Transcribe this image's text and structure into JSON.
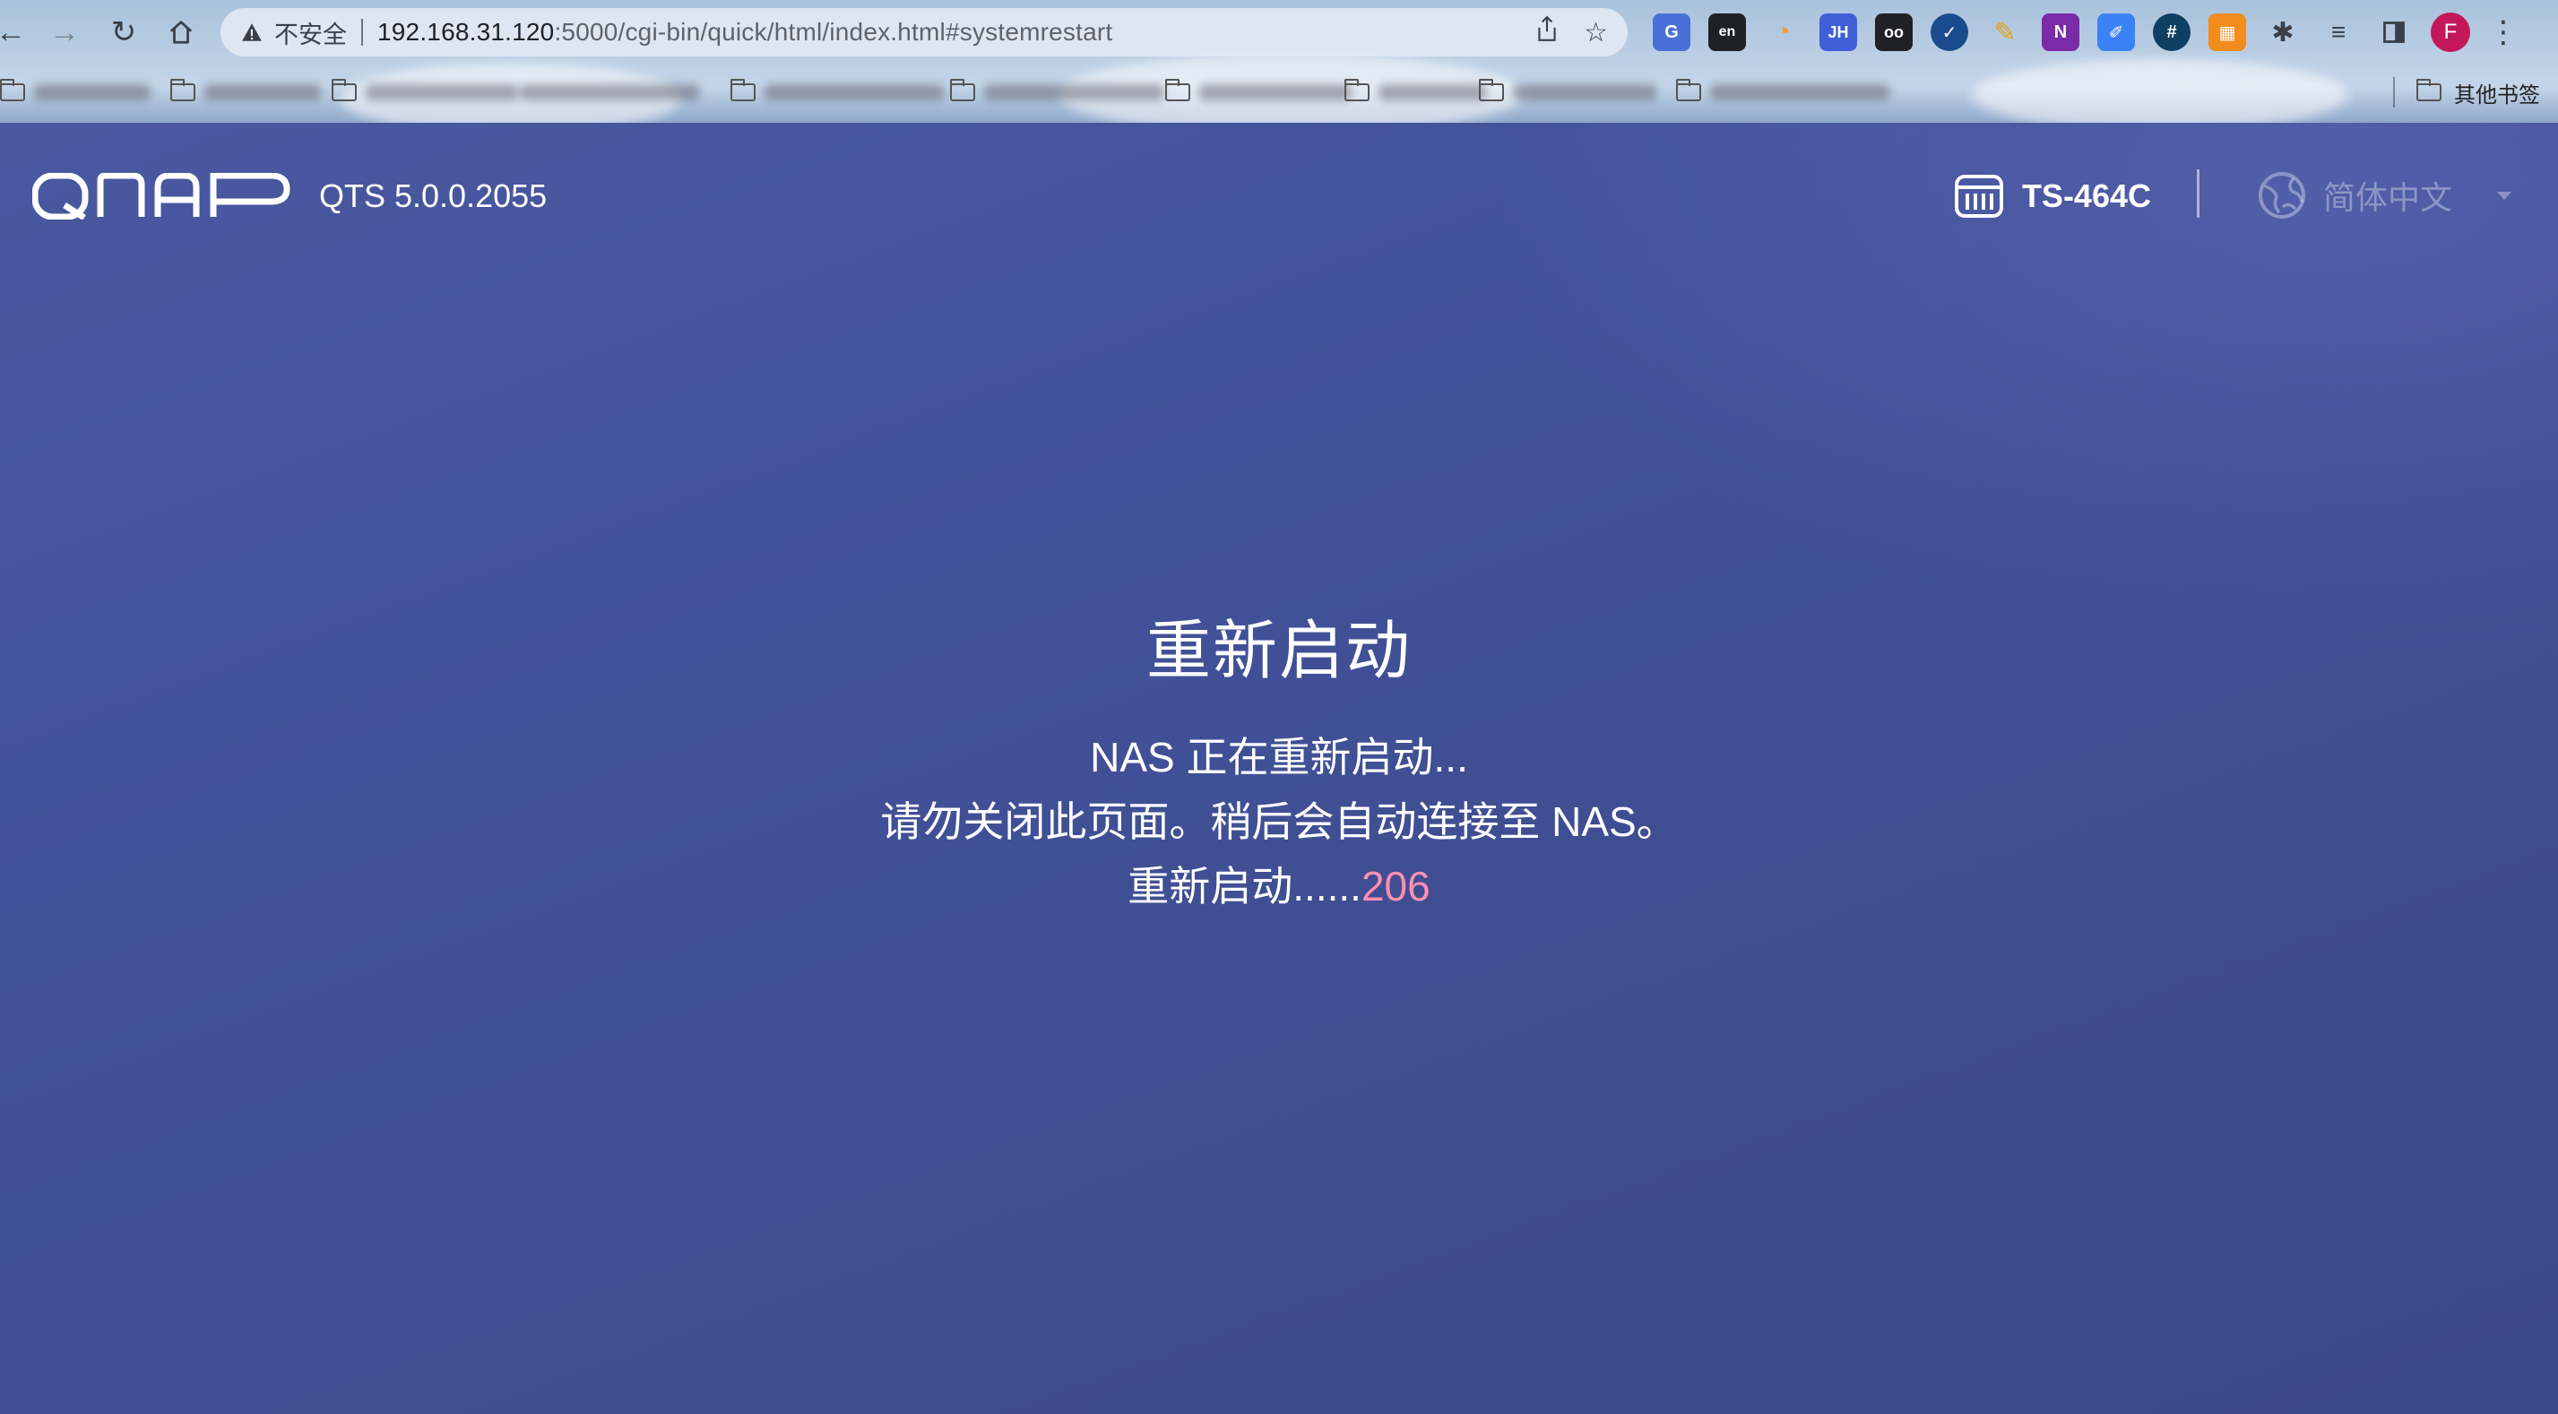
{
  "browser": {
    "security_label": "不安全",
    "url_main": "192.168.31.120",
    "url_rest": ":5000/cgi-bin/quick/html/index.html#systemrestart",
    "other_bookmarks": "其他书签",
    "profile_initial": "F",
    "extensions": [
      {
        "name": "google-translate-icon",
        "label": "G",
        "color": "#4a6fd6"
      },
      {
        "name": "dict-ext-icon",
        "label": "en",
        "color": "#202124"
      },
      {
        "name": "loading-ext-icon",
        "label": "◔",
        "color": "#f0a030"
      },
      {
        "name": "jh-ext-icon",
        "label": "JH",
        "color": "#3f5fd6"
      },
      {
        "name": "glasses-ext-icon",
        "label": "oo",
        "color": "#202124"
      },
      {
        "name": "check-ext-icon",
        "label": "✓",
        "color": "#1b4b8f"
      },
      {
        "name": "note-ext-icon",
        "label": "✎",
        "color": "#e8a21a"
      },
      {
        "name": "onenote-ext-icon",
        "label": "N",
        "color": "#7b2aa8"
      },
      {
        "name": "pen-ext-icon",
        "label": "✐",
        "color": "#3b82f6"
      },
      {
        "name": "hash-ext-icon",
        "label": "#",
        "color": "#0f3f63"
      },
      {
        "name": "grid-ext-icon",
        "label": "▦",
        "color": "#f28c1c"
      }
    ]
  },
  "header": {
    "brand": "QNAP",
    "version": "QTS 5.0.0.2055",
    "model": "TS-464C",
    "language": "简体中文"
  },
  "restart": {
    "title": "重新启动",
    "message": "NAS 正在重新启动...",
    "notice": "请勿关闭此页面。稍后会自动连接至 NAS。",
    "progress_prefix": "重新启动......",
    "countdown": "206"
  }
}
